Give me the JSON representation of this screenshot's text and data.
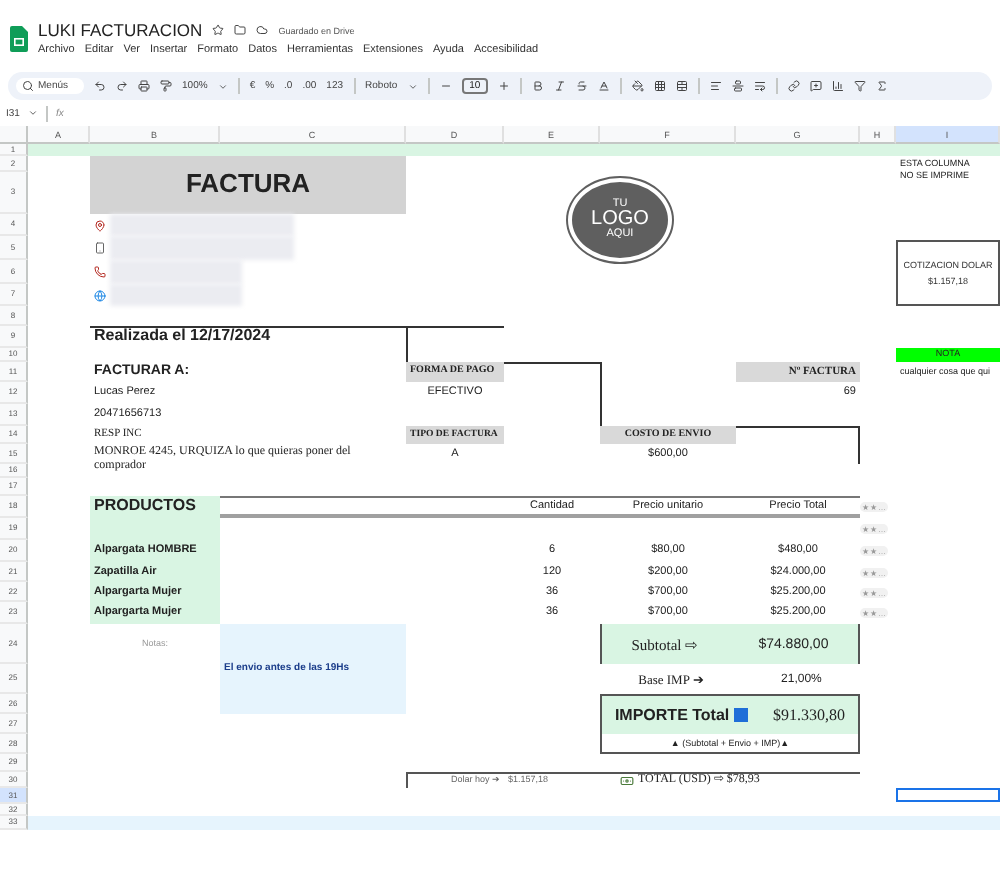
{
  "app": {
    "title": "LUKI FACTURACION",
    "save_status": "Guardado en Drive"
  },
  "menu": [
    "Archivo",
    "Editar",
    "Ver",
    "Insertar",
    "Formato",
    "Datos",
    "Herramientas",
    "Extensiones",
    "Ayuda",
    "Accesibilidad"
  ],
  "toolbar": {
    "search": "Menús",
    "zoom": "100%",
    "currency": "€",
    "percent": "%",
    "decrease_decimals": ".0",
    "increase_decimals": ".00",
    "number_format": "123",
    "font": "Roboto",
    "font_size": "10"
  },
  "formula_bar": {
    "cell_ref": "I31",
    "fx": "fx"
  },
  "columns": [
    {
      "label": "A",
      "selected": false
    },
    {
      "label": "B",
      "selected": false
    },
    {
      "label": "C",
      "selected": false
    },
    {
      "label": "D",
      "selected": false
    },
    {
      "label": "E",
      "selected": false
    },
    {
      "label": "F",
      "selected": false
    },
    {
      "label": "G",
      "selected": false
    },
    {
      "label": "H",
      "selected": false
    },
    {
      "label": "I",
      "selected": true
    }
  ],
  "rows": [
    {
      "label": "1",
      "selected": false
    },
    {
      "label": "2",
      "selected": false
    },
    {
      "label": "3",
      "selected": false
    },
    {
      "label": "4",
      "selected": false
    },
    {
      "label": "5",
      "selected": false
    },
    {
      "label": "6",
      "selected": false
    },
    {
      "label": "7",
      "selected": false
    },
    {
      "label": "8",
      "selected": false
    },
    {
      "label": "9",
      "selected": false
    },
    {
      "label": "10",
      "selected": false
    },
    {
      "label": "11",
      "selected": false
    },
    {
      "label": "12",
      "selected": false
    },
    {
      "label": "13",
      "selected": false
    },
    {
      "label": "14",
      "selected": false
    },
    {
      "label": "15",
      "selected": false
    },
    {
      "label": "16",
      "selected": false
    },
    {
      "label": "17",
      "selected": false
    },
    {
      "label": "18",
      "selected": false
    },
    {
      "label": "19",
      "selected": false
    },
    {
      "label": "20",
      "selected": false
    },
    {
      "label": "21",
      "selected": false
    },
    {
      "label": "22",
      "selected": false
    },
    {
      "label": "23",
      "selected": false
    },
    {
      "label": "24",
      "selected": false
    },
    {
      "label": "25",
      "selected": false
    },
    {
      "label": "26",
      "selected": false
    },
    {
      "label": "27",
      "selected": false
    },
    {
      "label": "28",
      "selected": false
    },
    {
      "label": "29",
      "selected": false
    },
    {
      "label": "30",
      "selected": false
    },
    {
      "label": "31",
      "selected": true
    },
    {
      "label": "32",
      "selected": false
    },
    {
      "label": "33",
      "selected": false
    }
  ],
  "invoice": {
    "title": "FACTURA",
    "logo": [
      "TU",
      "LOGO",
      "AQUI"
    ],
    "contacts": [
      {
        "kind": "location"
      },
      {
        "kind": "mobile"
      },
      {
        "kind": "phone"
      },
      {
        "kind": "web"
      }
    ],
    "date": "Realizada el 12/17/2024",
    "bill_to": {
      "heading": "FACTURAR A:",
      "name": "Lucas Perez",
      "tax_id": "20471656713",
      "condition": "RESP INC",
      "address": "MONROE 4245, URQUIZA lo que quieras poner del comprador"
    },
    "payment": {
      "label": "FORMA DE PAGO",
      "value": "EFECTIVO"
    },
    "invoice_type": {
      "label": "TIPO DE FACTURA",
      "value": "A"
    },
    "shipping": {
      "label": "COSTO DE ENVIO",
      "value": "$600,00"
    },
    "invoice_number": {
      "label": "Nº FACTURA",
      "value": "69"
    },
    "products": {
      "heading": "PRODUCTOS",
      "columns": [
        "Cantidad",
        "Precio unitario",
        "Precio Total"
      ],
      "chips": [
        "★★…",
        "★★…",
        "★★…",
        "★★…",
        "★★…",
        "★★…"
      ],
      "items": [
        {
          "name": "Alpargata HOMBRE",
          "qty": "6",
          "unit": "$80,00",
          "total": "$480,00"
        },
        {
          "name": "Zapatilla Air",
          "qty": "120",
          "unit": "$200,00",
          "total": "$24.000,00"
        },
        {
          "name": "Alpargarta Mujer",
          "qty": "36",
          "unit": "$700,00",
          "total": "$25.200,00"
        },
        {
          "name": "Alpargarta Mujer",
          "qty": "36",
          "unit": "$700,00",
          "total": "$25.200,00"
        }
      ]
    },
    "notes": {
      "label": "Notas:",
      "text": "El envio antes de las 19Hs"
    },
    "subtotal": {
      "label": "Subtotal ⇨",
      "value": "$74.880,00"
    },
    "tax": {
      "label": "Base IMP ➔",
      "value": "21,00%"
    },
    "total": {
      "label": "IMPORTE Total",
      "value": "$91.330,80",
      "formula": "▲ (Subtotal + Envio + IMP)▲"
    },
    "usd": {
      "rate_label": "Dolar hoy ➔",
      "rate": "$1.157,18",
      "total": "TOTAL (USD) ⇨ $78,93"
    }
  },
  "side": {
    "line_1": "ESTA COLUMNA",
    "line_2": "NO SE IMPRIME",
    "rate_label": "COTIZACION DOLAR",
    "rate_value": "$1.157,18",
    "note_label": "NOTA",
    "note_text": "cualquier cosa que qui"
  }
}
